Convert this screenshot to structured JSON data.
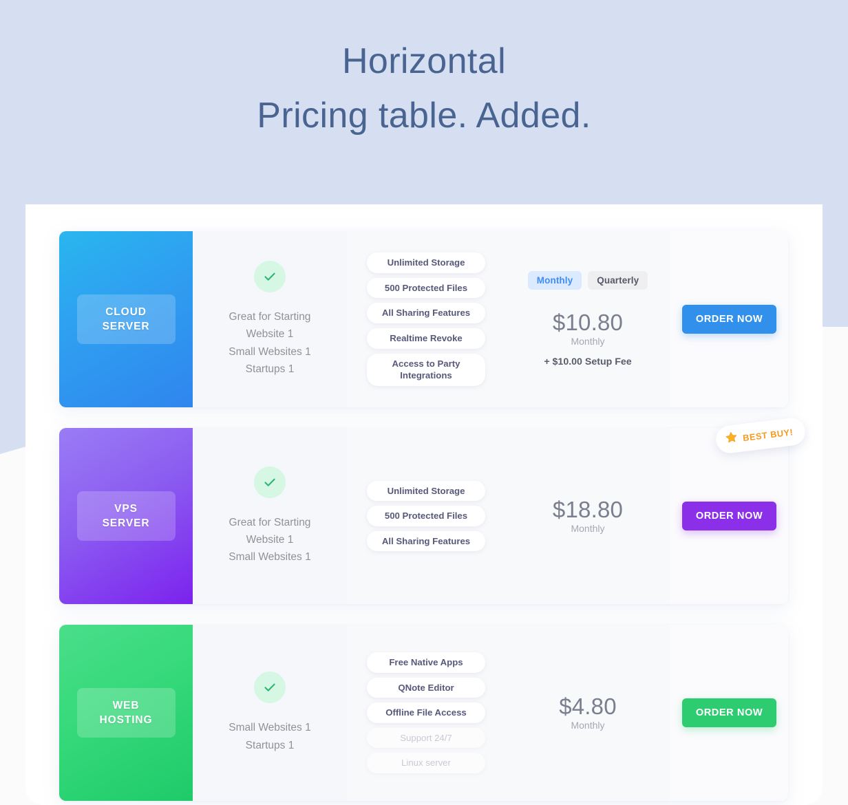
{
  "heading": {
    "line1": "Horizontal",
    "line2": "Pricing table. Added."
  },
  "colors": {
    "page_background": "#d6dff1",
    "heading_text": "#4a6491",
    "plan_blue": "#3190ec",
    "plan_purple": "#8b2fe8",
    "plan_green": "#2ecc71",
    "check_green": "#2bb673",
    "check_circle_bg": "#d6f7e4",
    "toggle_active_bg": "#dbeafe",
    "toggle_active_text": "#3f8cf5",
    "badge_orange": "#f59a1f",
    "pill_text": "#58597a",
    "pill_disabled_text": "#c7c9d4"
  },
  "badge": {
    "label": "BEST BUY!",
    "icon": "star-icon"
  },
  "plans": [
    {
      "id": "cloud-server",
      "name_line1": "CLOUD",
      "name_line2": "SERVER",
      "accent": "blue",
      "check_icon": "check-icon",
      "descriptions": [
        "Great for Starting",
        "Website 1",
        "Small Websites 1",
        "Startups 1"
      ],
      "features": [
        {
          "label": "Unlimited Storage",
          "enabled": true
        },
        {
          "label": "500 Protected Files",
          "enabled": true
        },
        {
          "label": "All Sharing Features",
          "enabled": true
        },
        {
          "label": "Realtime Revoke",
          "enabled": true
        },
        {
          "label": "Access to Party Integrations",
          "enabled": true
        }
      ],
      "billing_toggle": {
        "show": true,
        "options": [
          {
            "label": "Monthly",
            "active": true
          },
          {
            "label": "Quarterly",
            "active": false
          }
        ]
      },
      "price": "$10.80",
      "period": "Monthly",
      "note": "+ $10.00 Setup Fee",
      "cta_label": "ORDER NOW",
      "has_badge": false
    },
    {
      "id": "vps-server",
      "name_line1": "VPS",
      "name_line2": "SERVER",
      "accent": "purple",
      "check_icon": "check-icon",
      "descriptions": [
        "Great for Starting",
        "Website 1",
        "Small Websites 1"
      ],
      "features": [
        {
          "label": "Unlimited Storage",
          "enabled": true
        },
        {
          "label": "500 Protected Files",
          "enabled": true
        },
        {
          "label": "All Sharing Features",
          "enabled": true
        }
      ],
      "billing_toggle": {
        "show": false,
        "options": []
      },
      "price": "$18.80",
      "period": "Monthly",
      "note": "",
      "cta_label": "ORDER NOW",
      "has_badge": true
    },
    {
      "id": "web-hosting",
      "name_line1": "WEB",
      "name_line2": "HOSTING",
      "accent": "green",
      "check_icon": "check-icon",
      "descriptions": [
        "Small Websites 1",
        "Startups 1"
      ],
      "features": [
        {
          "label": "Free Native Apps",
          "enabled": true
        },
        {
          "label": "QNote Editor",
          "enabled": true
        },
        {
          "label": "Offline File Access",
          "enabled": true
        },
        {
          "label": "Support 24/7",
          "enabled": false
        },
        {
          "label": "Linux server",
          "enabled": false
        }
      ],
      "billing_toggle": {
        "show": false,
        "options": []
      },
      "price": "$4.80",
      "period": "Monthly",
      "note": "",
      "cta_label": "ORDER NOW",
      "has_badge": false
    }
  ]
}
